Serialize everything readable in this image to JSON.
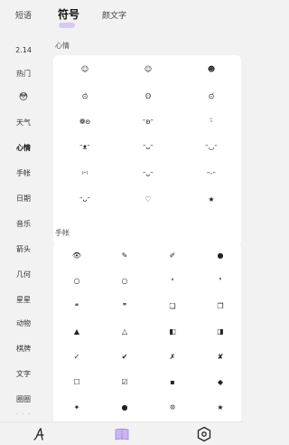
{
  "tabs": [
    "短语",
    "符号",
    "颜文字"
  ],
  "sidebar": [
    "2.14",
    "热门",
    "😳",
    "天气",
    "心情",
    "手帐",
    "日期",
    "音乐",
    "箭头",
    "几何",
    "星星",
    "动物",
    "棋牌",
    "文字",
    "圈圈"
  ],
  "sidebar_more": "· · ·",
  "sections": {
    "mood": {
      "title": "心情",
      "symbols": [
        "☺",
        "☺",
        "☻",
        "⊙̀",
        "ʘ",
        "⊙́",
        "❁ʚ",
        "ᵔʚᵔ",
        "ᵕ̈",
        "ᵔᴥᵔ",
        "ᵔᴗᵔ",
        "ᵔ◡ᵔ",
        "⁽ᵔ⁾",
        "ᵔᴗᵔ",
        "ᵔᵕᵔ",
        "ᵔᴗᵔ",
        "♡",
        "★"
      ]
    },
    "notebook": {
      "title": "手帐",
      "symbols": [
        "👁",
        "✎",
        "✐",
        "●",
        "○",
        "○",
        "❛",
        "❜",
        "❝",
        "❞",
        "❏",
        "❐",
        "▲",
        "△",
        "◧",
        "◨",
        "✓",
        "✔",
        "✗",
        "✘",
        "☐",
        "☑",
        "▪",
        "◆",
        "✦",
        "●",
        "❊",
        "★"
      ]
    }
  },
  "colors": {
    "accent": "#d7c8f5",
    "background": "#f2f2f2",
    "card": "#ffffff"
  },
  "bottom_icons": [
    "font-style-icon",
    "book-icon",
    "settings-hex-icon"
  ]
}
